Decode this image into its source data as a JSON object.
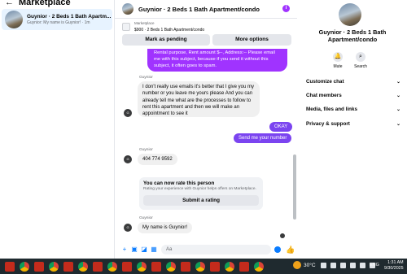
{
  "left_panel": {
    "back": "←",
    "title": "Marketplace",
    "conversations": [
      {
        "name": "Guynior · 2 Beds 1 Bath Apartm...",
        "snippet": "Guynior: My name is Guynior! · 1m"
      }
    ]
  },
  "chat": {
    "header_name": "Guynior · 2 Beds 1 Bath Apartment/condo",
    "info_icon": "i",
    "listing_label": "Marketplace",
    "listing_price": "$900 · 2 Beds 1 Bath Apartment/condo",
    "mark_pending": "Mark as pending",
    "more_options": "More options",
    "messages": {
      "purple_text": "Rental purpose, Rent amount $--, Address:-- Please email me with this subject, because if you send it without this subject, it often goes to spam.",
      "sender1": "Guynior",
      "msg1": "I don't really use emails it's better that I give you my number or you leave me yours please And you can already tell me what are the processes to follow to rent this apartment and then we will make an appointment to see it",
      "okay": "OKAY",
      "send_number": "Send me your number",
      "sender2": "Guynior",
      "msg2": "404 774 9592",
      "rate_title": "You can now rate this person",
      "rate_sub": "Rating your experience with Guynior helps offers on Marketplace.",
      "rate_button": "Submit a rating",
      "sender3": "Guynior",
      "msg3": "My name is Guynior!"
    },
    "composer_placeholder": "Aa"
  },
  "right_panel": {
    "name": "Guynior · 2 Beds 1 Bath Apartment/condo",
    "actions": [
      {
        "label": "Mute",
        "icon": "bell-icon"
      },
      {
        "label": "Search",
        "icon": "search-icon"
      }
    ],
    "sections": [
      "Customize chat",
      "Chat members",
      "Media, files and links",
      "Privacy & support"
    ]
  },
  "taskbar": {
    "temperature": "30°C",
    "language": "ENG",
    "time": "1:31 AM",
    "date": "9/30/2025"
  }
}
